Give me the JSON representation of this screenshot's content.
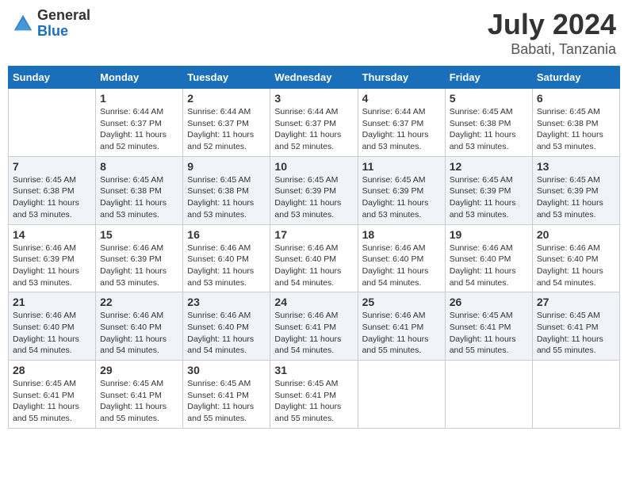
{
  "header": {
    "logo_general": "General",
    "logo_blue": "Blue",
    "month_year": "July 2024",
    "location": "Babati, Tanzania"
  },
  "weekdays": [
    "Sunday",
    "Monday",
    "Tuesday",
    "Wednesday",
    "Thursday",
    "Friday",
    "Saturday"
  ],
  "weeks": [
    [
      {
        "day": "",
        "sunrise": "",
        "sunset": "",
        "daylight": ""
      },
      {
        "day": "1",
        "sunrise": "Sunrise: 6:44 AM",
        "sunset": "Sunset: 6:37 PM",
        "daylight": "Daylight: 11 hours and 52 minutes."
      },
      {
        "day": "2",
        "sunrise": "Sunrise: 6:44 AM",
        "sunset": "Sunset: 6:37 PM",
        "daylight": "Daylight: 11 hours and 52 minutes."
      },
      {
        "day": "3",
        "sunrise": "Sunrise: 6:44 AM",
        "sunset": "Sunset: 6:37 PM",
        "daylight": "Daylight: 11 hours and 52 minutes."
      },
      {
        "day": "4",
        "sunrise": "Sunrise: 6:44 AM",
        "sunset": "Sunset: 6:37 PM",
        "daylight": "Daylight: 11 hours and 53 minutes."
      },
      {
        "day": "5",
        "sunrise": "Sunrise: 6:45 AM",
        "sunset": "Sunset: 6:38 PM",
        "daylight": "Daylight: 11 hours and 53 minutes."
      },
      {
        "day": "6",
        "sunrise": "Sunrise: 6:45 AM",
        "sunset": "Sunset: 6:38 PM",
        "daylight": "Daylight: 11 hours and 53 minutes."
      }
    ],
    [
      {
        "day": "7",
        "sunrise": "Sunrise: 6:45 AM",
        "sunset": "Sunset: 6:38 PM",
        "daylight": "Daylight: 11 hours and 53 minutes."
      },
      {
        "day": "8",
        "sunrise": "Sunrise: 6:45 AM",
        "sunset": "Sunset: 6:38 PM",
        "daylight": "Daylight: 11 hours and 53 minutes."
      },
      {
        "day": "9",
        "sunrise": "Sunrise: 6:45 AM",
        "sunset": "Sunset: 6:38 PM",
        "daylight": "Daylight: 11 hours and 53 minutes."
      },
      {
        "day": "10",
        "sunrise": "Sunrise: 6:45 AM",
        "sunset": "Sunset: 6:39 PM",
        "daylight": "Daylight: 11 hours and 53 minutes."
      },
      {
        "day": "11",
        "sunrise": "Sunrise: 6:45 AM",
        "sunset": "Sunset: 6:39 PM",
        "daylight": "Daylight: 11 hours and 53 minutes."
      },
      {
        "day": "12",
        "sunrise": "Sunrise: 6:45 AM",
        "sunset": "Sunset: 6:39 PM",
        "daylight": "Daylight: 11 hours and 53 minutes."
      },
      {
        "day": "13",
        "sunrise": "Sunrise: 6:45 AM",
        "sunset": "Sunset: 6:39 PM",
        "daylight": "Daylight: 11 hours and 53 minutes."
      }
    ],
    [
      {
        "day": "14",
        "sunrise": "Sunrise: 6:46 AM",
        "sunset": "Sunset: 6:39 PM",
        "daylight": "Daylight: 11 hours and 53 minutes."
      },
      {
        "day": "15",
        "sunrise": "Sunrise: 6:46 AM",
        "sunset": "Sunset: 6:39 PM",
        "daylight": "Daylight: 11 hours and 53 minutes."
      },
      {
        "day": "16",
        "sunrise": "Sunrise: 6:46 AM",
        "sunset": "Sunset: 6:40 PM",
        "daylight": "Daylight: 11 hours and 53 minutes."
      },
      {
        "day": "17",
        "sunrise": "Sunrise: 6:46 AM",
        "sunset": "Sunset: 6:40 PM",
        "daylight": "Daylight: 11 hours and 54 minutes."
      },
      {
        "day": "18",
        "sunrise": "Sunrise: 6:46 AM",
        "sunset": "Sunset: 6:40 PM",
        "daylight": "Daylight: 11 hours and 54 minutes."
      },
      {
        "day": "19",
        "sunrise": "Sunrise: 6:46 AM",
        "sunset": "Sunset: 6:40 PM",
        "daylight": "Daylight: 11 hours and 54 minutes."
      },
      {
        "day": "20",
        "sunrise": "Sunrise: 6:46 AM",
        "sunset": "Sunset: 6:40 PM",
        "daylight": "Daylight: 11 hours and 54 minutes."
      }
    ],
    [
      {
        "day": "21",
        "sunrise": "Sunrise: 6:46 AM",
        "sunset": "Sunset: 6:40 PM",
        "daylight": "Daylight: 11 hours and 54 minutes."
      },
      {
        "day": "22",
        "sunrise": "Sunrise: 6:46 AM",
        "sunset": "Sunset: 6:40 PM",
        "daylight": "Daylight: 11 hours and 54 minutes."
      },
      {
        "day": "23",
        "sunrise": "Sunrise: 6:46 AM",
        "sunset": "Sunset: 6:40 PM",
        "daylight": "Daylight: 11 hours and 54 minutes."
      },
      {
        "day": "24",
        "sunrise": "Sunrise: 6:46 AM",
        "sunset": "Sunset: 6:41 PM",
        "daylight": "Daylight: 11 hours and 54 minutes."
      },
      {
        "day": "25",
        "sunrise": "Sunrise: 6:46 AM",
        "sunset": "Sunset: 6:41 PM",
        "daylight": "Daylight: 11 hours and 55 minutes."
      },
      {
        "day": "26",
        "sunrise": "Sunrise: 6:45 AM",
        "sunset": "Sunset: 6:41 PM",
        "daylight": "Daylight: 11 hours and 55 minutes."
      },
      {
        "day": "27",
        "sunrise": "Sunrise: 6:45 AM",
        "sunset": "Sunset: 6:41 PM",
        "daylight": "Daylight: 11 hours and 55 minutes."
      }
    ],
    [
      {
        "day": "28",
        "sunrise": "Sunrise: 6:45 AM",
        "sunset": "Sunset: 6:41 PM",
        "daylight": "Daylight: 11 hours and 55 minutes."
      },
      {
        "day": "29",
        "sunrise": "Sunrise: 6:45 AM",
        "sunset": "Sunset: 6:41 PM",
        "daylight": "Daylight: 11 hours and 55 minutes."
      },
      {
        "day": "30",
        "sunrise": "Sunrise: 6:45 AM",
        "sunset": "Sunset: 6:41 PM",
        "daylight": "Daylight: 11 hours and 55 minutes."
      },
      {
        "day": "31",
        "sunrise": "Sunrise: 6:45 AM",
        "sunset": "Sunset: 6:41 PM",
        "daylight": "Daylight: 11 hours and 55 minutes."
      },
      {
        "day": "",
        "sunrise": "",
        "sunset": "",
        "daylight": ""
      },
      {
        "day": "",
        "sunrise": "",
        "sunset": "",
        "daylight": ""
      },
      {
        "day": "",
        "sunrise": "",
        "sunset": "",
        "daylight": ""
      }
    ]
  ]
}
